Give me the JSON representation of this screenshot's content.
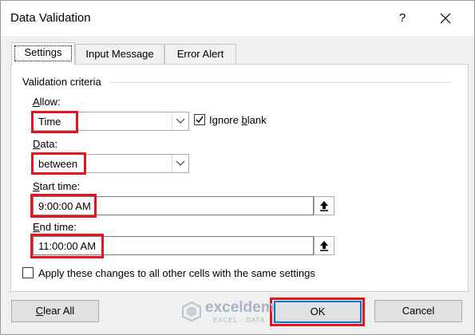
{
  "dialog": {
    "title": "Data Validation",
    "help_label": "?"
  },
  "tabs": [
    {
      "label": "Settings",
      "active": true
    },
    {
      "label": "Input Message",
      "active": false
    },
    {
      "label": "Error Alert",
      "active": false
    }
  ],
  "criteria": {
    "group_title": "Validation criteria",
    "allow": {
      "label_prefix": "",
      "label_underlined": "A",
      "label_rest": "llow:",
      "value": "Time"
    },
    "ignore_blank": {
      "label_prefix": "Ignore ",
      "label_underlined": "b",
      "label_rest": "lank",
      "checked": true
    },
    "data": {
      "label_prefix": "",
      "label_underlined": "D",
      "label_rest": "ata:",
      "value": "between"
    },
    "start_time": {
      "label_prefix": "",
      "label_underlined": "S",
      "label_rest": "tart time:",
      "value": "9:00:00 AM"
    },
    "end_time": {
      "label_prefix": "",
      "label_underlined": "E",
      "label_rest": "nd time:",
      "value": "11:00:00 AM"
    },
    "apply_all": {
      "label_prefix": "Apply ",
      "label_underlined": "",
      "label_rest": "these changes to all other cells with the same settings",
      "checked": false
    }
  },
  "buttons": {
    "clear_all": {
      "label_prefix": "",
      "label_underlined": "C",
      "label_rest": "lear All"
    },
    "ok": "OK",
    "cancel": "Cancel"
  },
  "watermark": {
    "name": "exceldemy",
    "tagline": "EXCEL · DATA · BI"
  },
  "colors": {
    "highlight": "#e8141b",
    "focus": "#0078d7"
  }
}
